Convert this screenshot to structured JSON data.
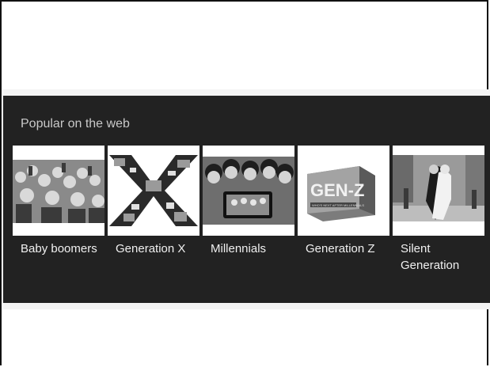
{
  "panel": {
    "title": "Popular on the web"
  },
  "cards": [
    {
      "label": "Baby boomers",
      "icon": "crowd-photo-icon"
    },
    {
      "label": "Generation X",
      "icon": "x-collage-icon"
    },
    {
      "label": "Millennials",
      "icon": "group-selfie-icon"
    },
    {
      "label": "Generation Z",
      "icon": "genz-box-icon"
    },
    {
      "label": "Silent Generation",
      "icon": "street-kiss-photo-icon"
    }
  ],
  "book_text": {
    "brand": "GEN-Z",
    "subtitle": "WHO'S NEXT AFTER MILLENNIALS"
  },
  "colors": {
    "panel_bg": "#222222",
    "title_text": "#c9c9c9",
    "caption_text": "#f0f0f0"
  }
}
